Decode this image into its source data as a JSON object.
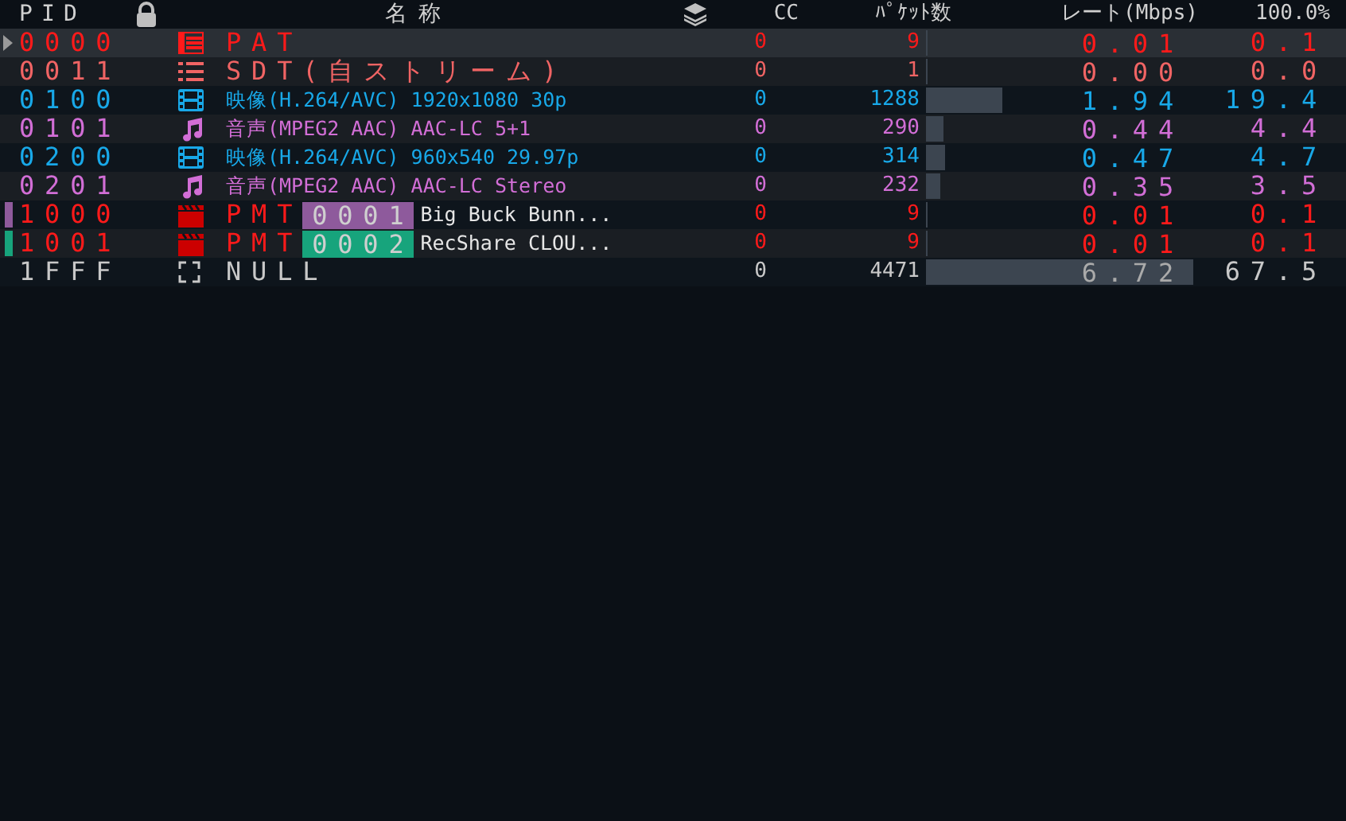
{
  "header": {
    "pid": "PID",
    "name": "名称",
    "cc": "CC",
    "packets": "ﾊﾟｹｯﾄ数",
    "rate": "レート(Mbps)",
    "percent": "100.0%"
  },
  "rows": [
    {
      "pid": "0000",
      "kind": "table",
      "name": "PAT",
      "cc": "0",
      "packets": "9",
      "rate": "0.01",
      "percent": "0.1",
      "color": "#ff1a1a",
      "selected": true
    },
    {
      "pid": "0011",
      "kind": "list",
      "name": "SDT(自ストリーム)",
      "cc": "0",
      "packets": "1",
      "rate": "0.00",
      "percent": "0.0",
      "color": "#f06464",
      "selected": false
    },
    {
      "pid": "0100",
      "kind": "film",
      "name": "映像(H.264/AVC) 1920x1080 30p",
      "cc": "0",
      "packets": "1288",
      "rate": "1.94",
      "percent": "19.4",
      "color": "#18a8e8",
      "selected": false
    },
    {
      "pid": "0101",
      "kind": "music",
      "name": "音声(MPEG2 AAC) AAC-LC 5+1",
      "cc": "0",
      "packets": "290",
      "rate": "0.44",
      "percent": "4.4",
      "color": "#d26ed6",
      "selected": false
    },
    {
      "pid": "0200",
      "kind": "film",
      "name": "映像(H.264/AVC) 960x540 29.97p",
      "cc": "0",
      "packets": "314",
      "rate": "0.47",
      "percent": "4.7",
      "color": "#18a8e8",
      "selected": false
    },
    {
      "pid": "0201",
      "kind": "music",
      "name": "音声(MPEG2 AAC) AAC-LC Stereo",
      "cc": "0",
      "packets": "232",
      "rate": "0.35",
      "percent": "3.5",
      "color": "#d26ed6",
      "selected": false
    },
    {
      "pid": "1000",
      "kind": "clapper",
      "name": "PMT",
      "program": {
        "number": "0001",
        "color": "#8e5a9c"
      },
      "service": "Big Buck Bunn...",
      "cc": "0",
      "packets": "9",
      "rate": "0.01",
      "percent": "0.1",
      "color": "#ff1a1a",
      "selected": false
    },
    {
      "pid": "1001",
      "kind": "clapper",
      "name": "PMT",
      "program": {
        "number": "0002",
        "color": "#17a47c"
      },
      "service": "RecShare CLOU...",
      "cc": "0",
      "packets": "9",
      "rate": "0.01",
      "percent": "0.1",
      "color": "#ff1a1a",
      "selected": false
    },
    {
      "pid": "1FFF",
      "kind": "null",
      "name": "NULL",
      "cc": "0",
      "packets": "4471",
      "rate": "6.72",
      "percent": "67.5",
      "color": "#c8c8c8",
      "selected": false
    }
  ]
}
